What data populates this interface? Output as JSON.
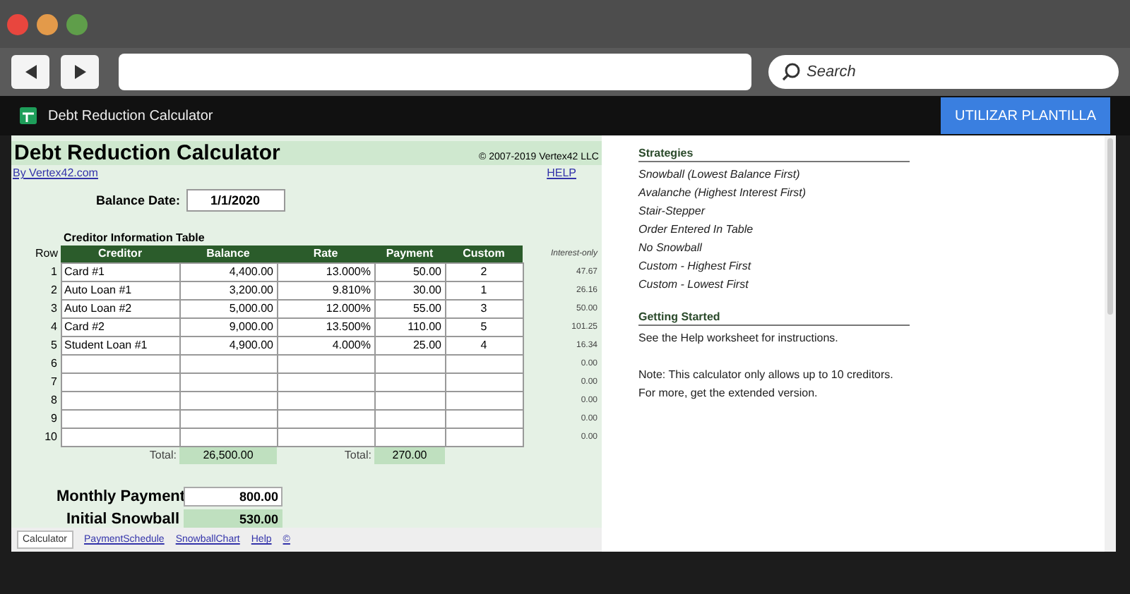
{
  "toolbar": {
    "search": {
      "placeholder": "Search"
    }
  },
  "doc_bar": {
    "title": "Debt Reduction Calculator",
    "button": "UTILIZAR PLANTILLA"
  },
  "sheet": {
    "title": "Debt Reduction Calculator",
    "copyright": "© 2007-2019 Vertex42 LLC",
    "by_link": "By Vertex42.com",
    "help_link": "HELP",
    "balance_date": {
      "label": "Balance Date:",
      "value": "1/1/2020"
    },
    "table_title": "Creditor Information Table",
    "columns": [
      "Row",
      "Creditor",
      "Balance",
      "Rate",
      "Payment",
      "Custom"
    ],
    "side_header": "Interest-only",
    "rows": [
      {
        "row": "1",
        "creditor": "Card #1",
        "balance": "4,400.00",
        "rate": "13.000%",
        "payment": "50.00",
        "custom": "2",
        "interest": "47.67"
      },
      {
        "row": "2",
        "creditor": "Auto Loan #1",
        "balance": "3,200.00",
        "rate": "9.810%",
        "payment": "30.00",
        "custom": "1",
        "interest": "26.16"
      },
      {
        "row": "3",
        "creditor": "Auto Loan #2",
        "balance": "5,000.00",
        "rate": "12.000%",
        "payment": "55.00",
        "custom": "3",
        "interest": "50.00"
      },
      {
        "row": "4",
        "creditor": "Card #2",
        "balance": "9,000.00",
        "rate": "13.500%",
        "payment": "110.00",
        "custom": "5",
        "interest": "101.25"
      },
      {
        "row": "5",
        "creditor": "Student Loan #1",
        "balance": "4,900.00",
        "rate": "4.000%",
        "payment": "25.00",
        "custom": "4",
        "interest": "16.34"
      },
      {
        "row": "6",
        "interest": "0.00"
      },
      {
        "row": "7",
        "interest": "0.00"
      },
      {
        "row": "8",
        "interest": "0.00"
      },
      {
        "row": "9",
        "interest": "0.00"
      },
      {
        "row": "10",
        "interest": "0.00"
      }
    ],
    "totals": [
      {
        "label": "Total:",
        "value": "26,500.00"
      },
      {
        "label": "Total:",
        "value": "270.00"
      }
    ],
    "monthly_payment": {
      "label": "Monthly Payment",
      "value": "800.00"
    },
    "initial_snowball": {
      "label": "Initial Snowball",
      "value": "530.00"
    }
  },
  "side": {
    "sections": [
      {
        "heading": "Strategies",
        "kind": "italic-list",
        "paragraphs": [
          [
            "Snowball (Lowest Balance First)",
            "Avalanche (Highest Interest First)",
            "Stair-Stepper",
            "Order Entered In Table",
            "No Snowball",
            "Custom - Highest First",
            "Custom - Lowest First"
          ]
        ]
      },
      {
        "heading": "Getting Started",
        "kind": "paragraphs",
        "paragraphs": [
          [
            "See the Help worksheet for instructions."
          ],
          [
            "Note: This calculator only allows up to 10 creditors.",
            "For more, get the extended version."
          ]
        ]
      }
    ]
  },
  "sheet_tabs": [
    {
      "label": "Calculator",
      "selected": true
    },
    {
      "label": "PaymentSchedule",
      "selected": false
    },
    {
      "label": "SnowballChart",
      "selected": false
    },
    {
      "label": "Help",
      "selected": false
    },
    {
      "label": "©",
      "selected": false
    }
  ]
}
